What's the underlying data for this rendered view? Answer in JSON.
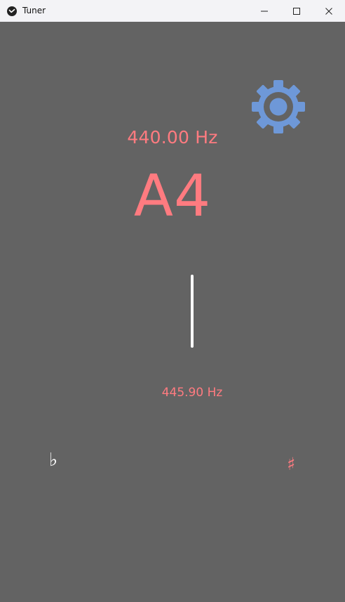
{
  "window": {
    "title": "Tuner"
  },
  "tuner": {
    "target_frequency": "440.00 Hz",
    "note": "A4",
    "detected_frequency": "445.90 Hz"
  },
  "controls": {
    "flat_symbol": "♭",
    "sharp_symbol": "♯",
    "settings_icon": "gear-icon"
  },
  "colors": {
    "background": "#636363",
    "text_accent": "#ff7b80",
    "settings_icon": "#6e98d8",
    "needle": "#ffffff"
  }
}
